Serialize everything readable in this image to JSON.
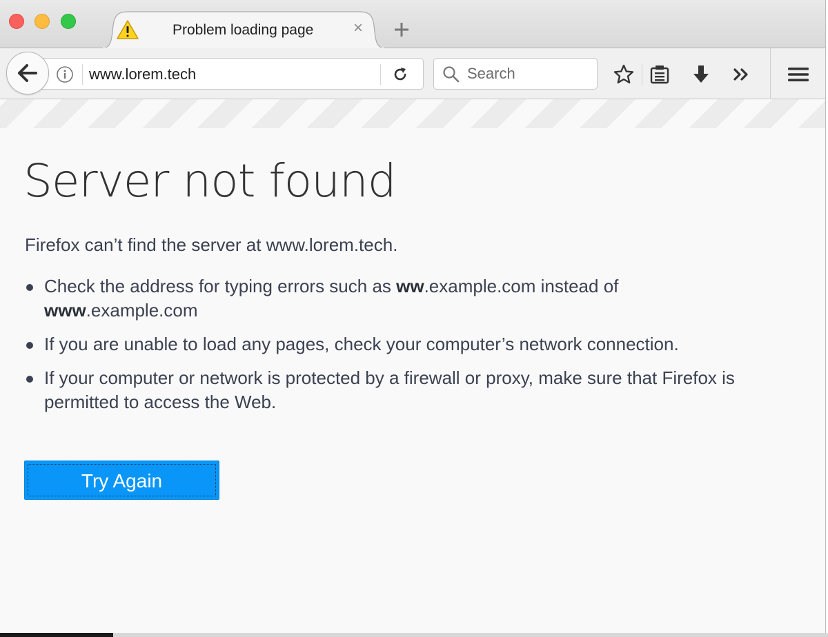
{
  "tab": {
    "title": "Problem loading page",
    "close_glyph": "×",
    "icon": "warning-icon"
  },
  "navbar": {
    "url": "www.lorem.tech",
    "search_placeholder": "Search",
    "icons": [
      "back-arrow-icon",
      "info-icon",
      "reload-icon",
      "search-icon",
      "bookmark-star-icon",
      "reading-list-icon",
      "download-icon",
      "overflow-chevron-icon",
      "hamburger-menu-icon"
    ]
  },
  "error": {
    "title": "Server not found",
    "lead": "Firefox can’t find the server at www.lorem.tech.",
    "bullet1": {
      "pre": "Check the address for typing errors such as ",
      "bold1": "ww",
      "mid": ".example.com instead of ",
      "bold2": "www",
      "post": ".example.com"
    },
    "bullet2": "If you are unable to load any pages, check your computer’s network connection.",
    "bullet3": "If your computer or network is protected by a firewall or proxy, make sure that Firefox is permitted to access the Web.",
    "button_label": "Try Again"
  },
  "colors": {
    "accent": "#0996f8",
    "text": "#3b4150"
  }
}
